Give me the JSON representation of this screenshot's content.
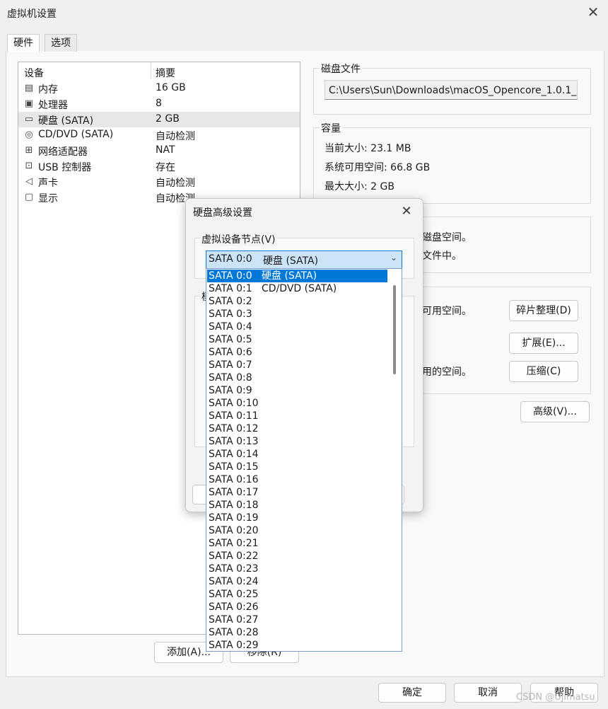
{
  "window": {
    "title": "虚拟机设置"
  },
  "tabs": [
    "硬件",
    "选项"
  ],
  "device_list": {
    "headers": [
      "设备",
      "摘要"
    ],
    "rows": [
      {
        "icon": "memory-icon",
        "name": "内存",
        "summary": "16 GB"
      },
      {
        "icon": "cpu-icon",
        "name": "处理器",
        "summary": "8"
      },
      {
        "icon": "harddisk-icon",
        "name": "硬盘 (SATA)",
        "summary": "2 GB"
      },
      {
        "icon": "cd-dvd-icon",
        "name": "CD/DVD (SATA)",
        "summary": "自动检测"
      },
      {
        "icon": "network-adapter-icon",
        "name": "网络适配器",
        "summary": "NAT"
      },
      {
        "icon": "usb-icon",
        "name": "USB 控制器",
        "summary": "存在"
      },
      {
        "icon": "speaker-icon",
        "name": "声卡",
        "summary": "自动检测"
      },
      {
        "icon": "display-icon",
        "name": "显示",
        "summary": "自动检测"
      }
    ],
    "selected_index": 2
  },
  "buttons": {
    "add": "添加(A)...",
    "remove": "移除(R)",
    "defrag": "碎片整理(D)",
    "expand": "扩展(E)...",
    "compact": "压缩(C)",
    "advanced": "高级(V)...",
    "ok": "确定",
    "cancel": "取消",
    "help": "帮助"
  },
  "disk_file": {
    "title": "磁盘文件",
    "path": "C:\\Users\\Sun\\Downloads\\macOS_Opencore_1.0.1_8_"
  },
  "capacity": {
    "title": "容量",
    "current_size": "当前大小: 23.1 MB",
    "free_space": "系统可用空间: 66.8 GB",
    "max_size": "最大大小: 2 GB"
  },
  "info_partial": {
    "line1": "磁盘空间。",
    "line2": "文件中。"
  },
  "util_partial": {
    "line1": "可用空间。",
    "line2": "用的空间。"
  },
  "advanced_dialog": {
    "title": "硬盘高级设置",
    "node_group_label": "虚拟设备节点(V)",
    "selected_node": "SATA 0:0",
    "selected_device": "硬盘 (SATA)",
    "hidden_group_glimpse": "模",
    "options": [
      "SATA 0:0   硬盘 (SATA)",
      "SATA 0:1   CD/DVD (SATA)",
      "SATA 0:2",
      "SATA 0:3",
      "SATA 0:4",
      "SATA 0:5",
      "SATA 0:6",
      "SATA 0:7",
      "SATA 0:8",
      "SATA 0:9",
      "SATA 0:10",
      "SATA 0:11",
      "SATA 0:12",
      "SATA 0:13",
      "SATA 0:14",
      "SATA 0:15",
      "SATA 0:16",
      "SATA 0:17",
      "SATA 0:18",
      "SATA 0:19",
      "SATA 0:20",
      "SATA 0:21",
      "SATA 0:22",
      "SATA 0:23",
      "SATA 0:24",
      "SATA 0:25",
      "SATA 0:26",
      "SATA 0:27",
      "SATA 0:28",
      "SATA 0:29"
    ],
    "selected_option_index": 0
  },
  "watermark": "CSDN @Ujimatsu"
}
